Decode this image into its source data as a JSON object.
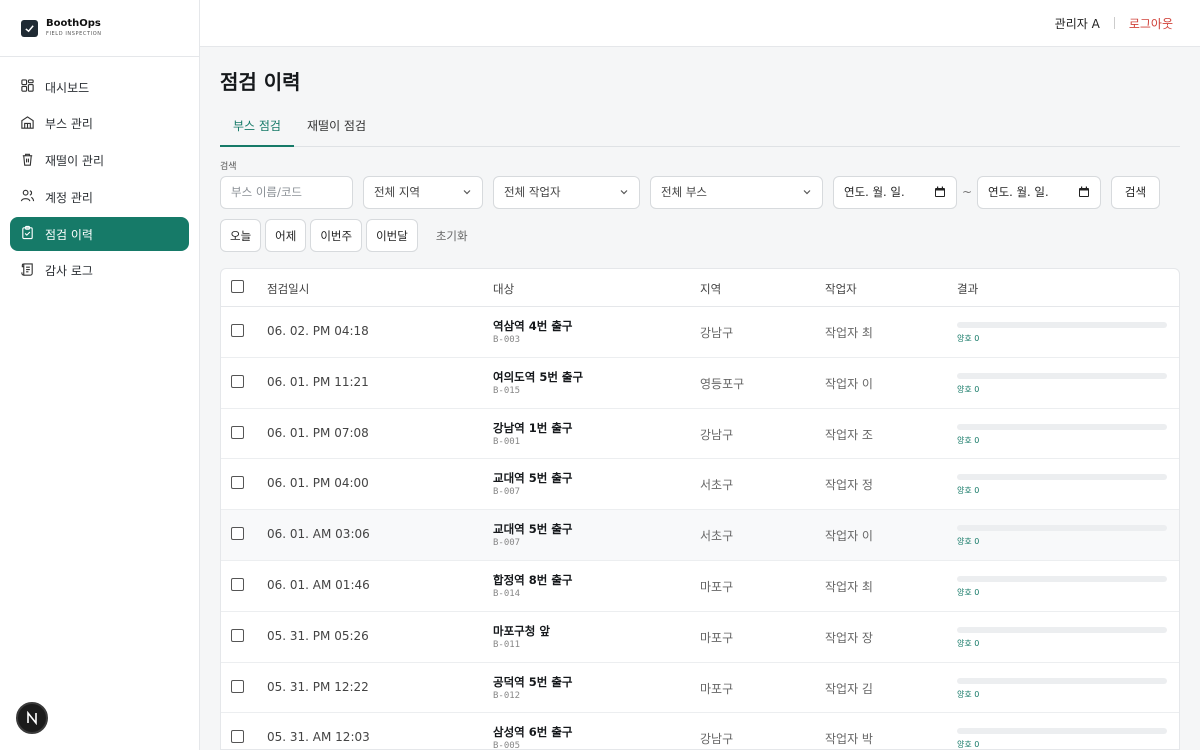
{
  "brand": {
    "name": "BoothOps",
    "subtitle": "FIELD INSPECTION"
  },
  "sidebar": {
    "items": [
      {
        "label": "대시보드",
        "icon": "grid-icon"
      },
      {
        "label": "부스 관리",
        "icon": "building-icon"
      },
      {
        "label": "재떨이 관리",
        "icon": "trash-icon"
      },
      {
        "label": "계정 관리",
        "icon": "users-icon"
      },
      {
        "label": "점검 이력",
        "icon": "clipboard-check-icon",
        "active": true
      },
      {
        "label": "감사 로그",
        "icon": "scroll-icon"
      }
    ]
  },
  "header": {
    "user": "관리자 A",
    "logout": "로그아웃"
  },
  "page": {
    "title": "점검 이력"
  },
  "tabs": [
    {
      "label": "부스 점검",
      "active": true
    },
    {
      "label": "재떨이 점검",
      "active": false
    }
  ],
  "filters": {
    "label": "검색",
    "search_placeholder": "부스 이름/코드",
    "region": "전체 지역",
    "worker": "전체 작업자",
    "booth": "전체 부스",
    "date_from": "연도. 월. 일.",
    "date_sep": "~",
    "date_to": "연도. 월. 일.",
    "search_button": "검색",
    "quick": [
      "오늘",
      "어제",
      "이번주",
      "이번달"
    ],
    "reset": "초기화"
  },
  "table": {
    "headers": [
      "점검일시",
      "대상",
      "지역",
      "작업자",
      "결과"
    ],
    "rows": [
      {
        "date": "06. 02. PM 04:18",
        "name": "역삼역 4번 출구",
        "code": "B-003",
        "region": "강남구",
        "worker": "작업자 최",
        "result": "양호 0"
      },
      {
        "date": "06. 01. PM 11:21",
        "name": "여의도역 5번 출구",
        "code": "B-015",
        "region": "영등포구",
        "worker": "작업자 이",
        "result": "양호 0"
      },
      {
        "date": "06. 01. PM 07:08",
        "name": "강남역 1번 출구",
        "code": "B-001",
        "region": "강남구",
        "worker": "작업자 조",
        "result": "양호 0"
      },
      {
        "date": "06. 01. PM 04:00",
        "name": "교대역 5번 출구",
        "code": "B-007",
        "region": "서초구",
        "worker": "작업자 정",
        "result": "양호 0"
      },
      {
        "date": "06. 01. AM 03:06",
        "name": "교대역 5번 출구",
        "code": "B-007",
        "region": "서초구",
        "worker": "작업자 이",
        "result": "양호 0"
      },
      {
        "date": "06. 01. AM 01:46",
        "name": "합정역 8번 출구",
        "code": "B-014",
        "region": "마포구",
        "worker": "작업자 최",
        "result": "양호 0"
      },
      {
        "date": "05. 31. PM 05:26",
        "name": "마포구청 앞",
        "code": "B-011",
        "region": "마포구",
        "worker": "작업자 장",
        "result": "양호 0"
      },
      {
        "date": "05. 31. PM 12:22",
        "name": "공덕역 5번 출구",
        "code": "B-012",
        "region": "마포구",
        "worker": "작업자 김",
        "result": "양호 0"
      },
      {
        "date": "05. 31. AM 12:03",
        "name": "삼성역 6번 출구",
        "code": "B-005",
        "region": "강남구",
        "worker": "작업자 박",
        "result": "양호 0"
      }
    ]
  },
  "badge": {
    "letter": "N"
  },
  "colors": {
    "accent": "#167a68",
    "logout": "#d0423a"
  }
}
